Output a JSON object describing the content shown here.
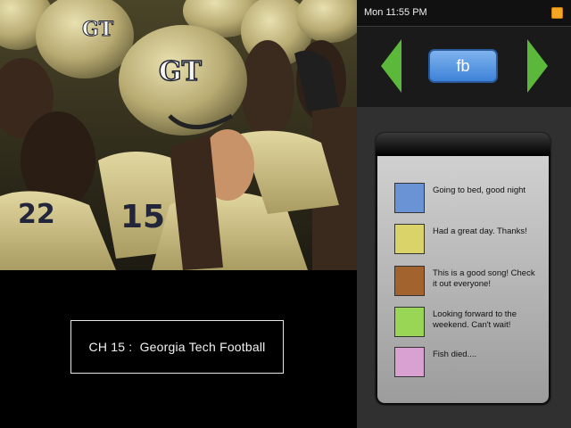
{
  "tv": {
    "channel_number": "CH 15",
    "separator": " :  ",
    "program_name": "Georgia Tech Football",
    "photo": {
      "helmet_logo": "GT",
      "jersey_numbers": [
        "15",
        "22"
      ]
    }
  },
  "status_bar": {
    "clock": "Mon 11:55 PM",
    "icon": "notification-square-icon",
    "icon_color": "#f5a623"
  },
  "nav": {
    "source_label": "fb",
    "prev_icon": "left-arrow-icon",
    "next_icon": "right-arrow-icon",
    "arrow_color": "#5cb83a",
    "button_color": "#3d82d8"
  },
  "feed": {
    "posts": [
      {
        "color": "#6a93d6",
        "text": "Going to bed, good night"
      },
      {
        "color": "#d9d36a",
        "text": "Had a great day. Thanks!"
      },
      {
        "color": "#a2632e",
        "text": "This is a good song! Check it out everyone!"
      },
      {
        "color": "#9ad655",
        "text": "Looking forward to the weekend. Can't wait!"
      },
      {
        "color": "#d9a0d2",
        "text": "Fish died...."
      }
    ]
  }
}
